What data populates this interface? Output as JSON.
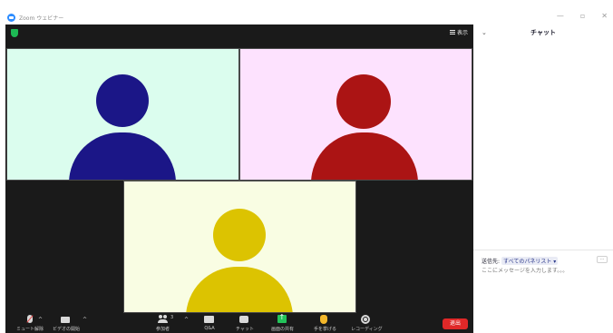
{
  "window": {
    "title": "Zoom ウェビナー",
    "controls": [
      "—",
      "▫",
      "✕"
    ]
  },
  "meeting": {
    "view_label": "表示",
    "participants": [
      {
        "bg": "#dbfdee",
        "avatar_color": "#1b1687"
      },
      {
        "bg": "#fde2fe",
        "avatar_color": "#ab1414"
      },
      {
        "bg": "#f9fde3",
        "avatar_color": "#dcc301"
      }
    ]
  },
  "toolbar": {
    "items": [
      {
        "name": "mute",
        "label": "ミュート解除",
        "icon": "mic-muted-icon"
      },
      {
        "name": "video",
        "label": "ビデオの開始",
        "icon": "camera-icon"
      },
      {
        "name": "participants",
        "label": "参加者",
        "count": "3",
        "icon": "participants-icon"
      },
      {
        "name": "poll",
        "label": "Q&A",
        "icon": "poll-icon"
      },
      {
        "name": "chat",
        "label": "チャット",
        "icon": "chat-icon"
      },
      {
        "name": "share",
        "label": "画面の共有",
        "icon": "share-screen-icon"
      },
      {
        "name": "raise-hand",
        "label": "手を挙げる",
        "icon": "raise-hand-icon"
      },
      {
        "name": "record",
        "label": "レコーディング",
        "icon": "record-icon"
      }
    ],
    "leave_label": "退出"
  },
  "chat": {
    "title": "チャット",
    "to_label": "送信先:",
    "to_value": "すべてのパネリスト",
    "placeholder": "ここにメッセージを入力します。。。",
    "more_label": "…"
  }
}
